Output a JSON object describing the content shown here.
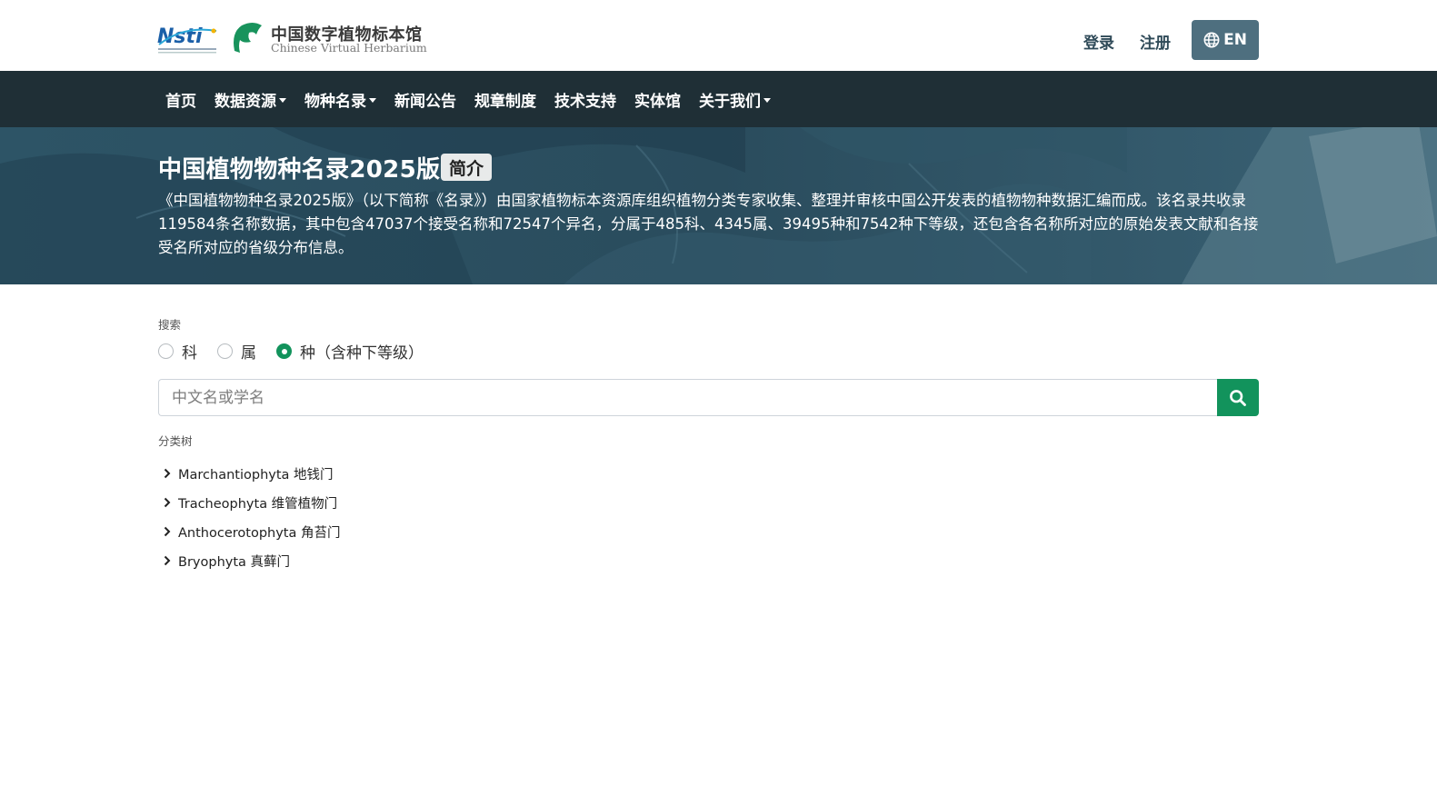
{
  "header": {
    "nsti_logo_text": "Nsti",
    "brand_cn": "中国数字植物标本馆",
    "brand_en": "Chinese Virtual Herbarium",
    "login": "登录",
    "register": "注册",
    "lang_button": "EN",
    "lang_icon": "globe-icon"
  },
  "nav": {
    "items": [
      {
        "label": "首页",
        "has_dropdown": false
      },
      {
        "label": "数据资源",
        "has_dropdown": true
      },
      {
        "label": "物种名录",
        "has_dropdown": true
      },
      {
        "label": "新闻公告",
        "has_dropdown": false
      },
      {
        "label": "规章制度",
        "has_dropdown": false
      },
      {
        "label": "技术支持",
        "has_dropdown": false
      },
      {
        "label": "实体馆",
        "has_dropdown": false
      },
      {
        "label": "关于我们",
        "has_dropdown": true
      }
    ]
  },
  "hero": {
    "title": "中国植物物种名录2025版",
    "intro_button": "简介",
    "description": "《中国植物物种名录2025版》（以下简称《名录》）由国家植物标本资源库组织植物分类专家收集、整理并审核中国公开发表的植物物种数据汇编而成。该名录共收录119584条名称数据，其中包含47037个接受名称和72547个异名，分属于485科、4345属、39495种和7542种下等级，还包含各名称所对应的原始发表文献和各接受名所对应的省级分布信息。"
  },
  "search": {
    "label": "搜索",
    "options": [
      {
        "label": "科",
        "checked": false
      },
      {
        "label": "属",
        "checked": false
      },
      {
        "label": "种（含种下等级）",
        "checked": true
      }
    ],
    "placeholder": "中文名或学名",
    "value": "",
    "button_icon": "search-icon"
  },
  "tree": {
    "label": "分类树",
    "items": [
      {
        "label": "Marchantiophyta 地钱门"
      },
      {
        "label": "Tracheophyta 维管植物门"
      },
      {
        "label": "Anthocerotophyta 角苔门"
      },
      {
        "label": "Bryophyta 真藓门"
      }
    ]
  },
  "colors": {
    "nav_bg": "#1f2f36",
    "hero_bg": "#2b4f61",
    "accent_green": "#12935c",
    "lang_btn": "#4e6f7f"
  }
}
